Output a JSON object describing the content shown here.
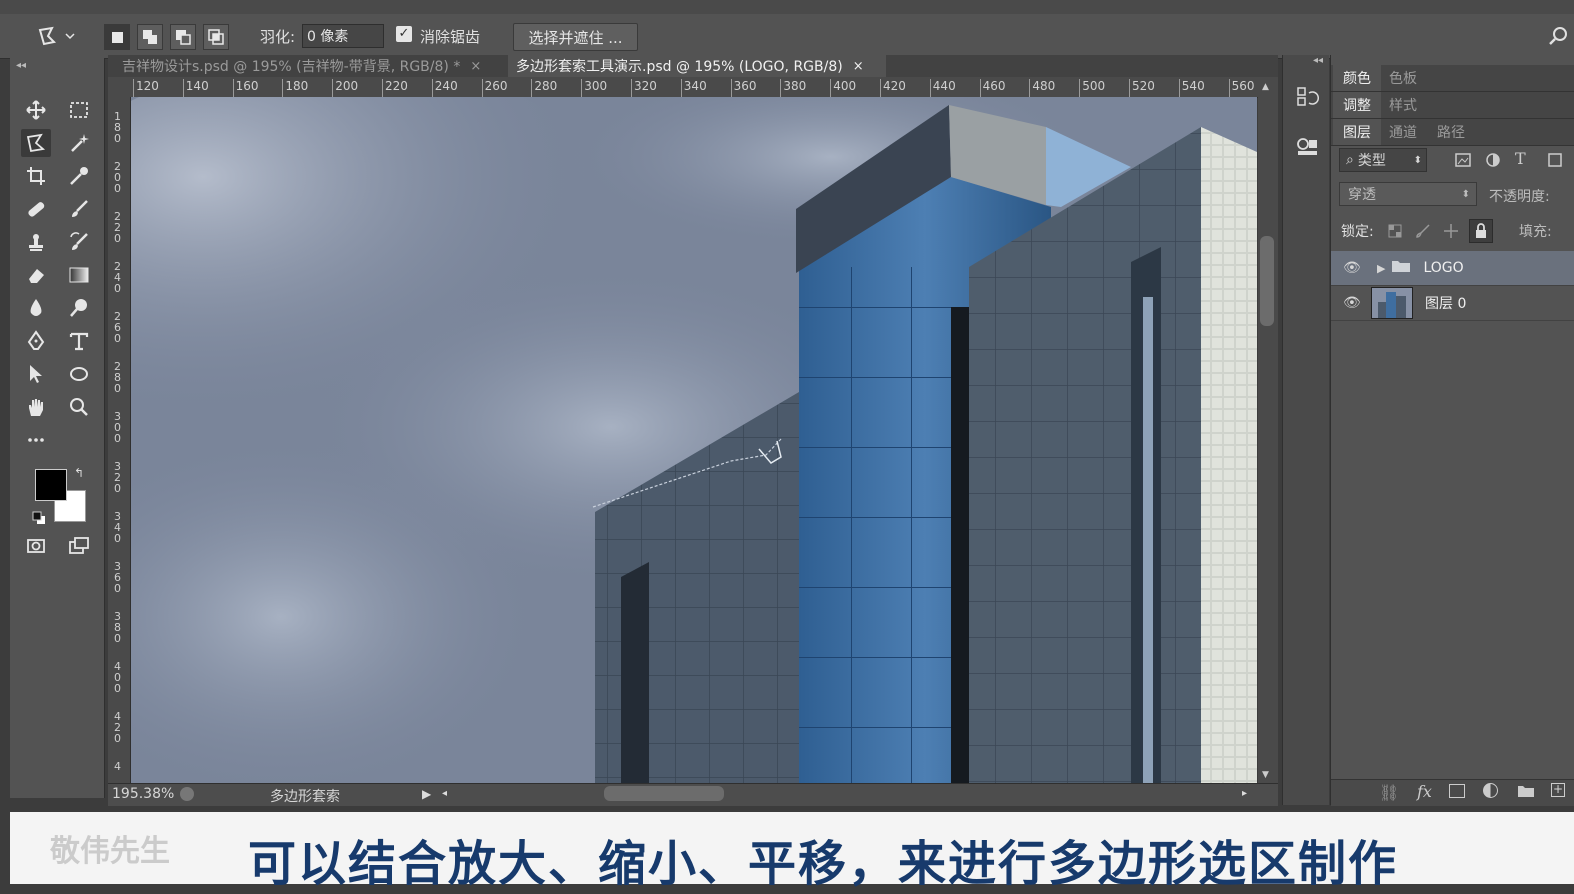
{
  "options_bar": {
    "feather_label": "羽化:",
    "feather_value": "0 像素",
    "antialias_label": "消除锯齿",
    "select_mask_label": "选择并遮住 ..."
  },
  "tabs": [
    {
      "label": "吉祥物设计s.psd @ 195% (吉祥物-带背景, RGB/8) *",
      "active": false
    },
    {
      "label": "多边形套索工具演示.psd @ 195% (LOGO, RGB/8)",
      "active": true
    }
  ],
  "tab_close": "×",
  "ruler_top_ticks": [
    "120",
    "140",
    "160",
    "180",
    "200",
    "220",
    "240",
    "260",
    "280",
    "300",
    "320",
    "340",
    "360",
    "380",
    "400",
    "420",
    "440",
    "460",
    "480",
    "500",
    "520",
    "540",
    "560"
  ],
  "ruler_left_ticks": [
    "1\n8\n0",
    "2\n0\n0",
    "2\n2\n0",
    "2\n4\n0",
    "2\n6\n0",
    "2\n8\n0",
    "3\n0\n0",
    "3\n2\n0",
    "3\n4\n0",
    "3\n6\n0",
    "3\n8\n0",
    "4\n0\n0",
    "4\n2\n0",
    "4"
  ],
  "status": {
    "zoom": "195.38%",
    "tool_name": "多边形套索"
  },
  "right_panel": {
    "tabs_row1": [
      "颜色",
      "色板"
    ],
    "tabs_row2": [
      "调整",
      "样式"
    ],
    "tabs_row3": [
      "图层",
      "通道",
      "路径"
    ],
    "filter_kind": "类型",
    "blend_mode": "穿透",
    "opacity_label": "不透明度:",
    "lock_label": "锁定:",
    "fill_label": "填充:",
    "layers": [
      {
        "name": "LOGO",
        "type": "group",
        "selected": true
      },
      {
        "name": "图层 0",
        "type": "image",
        "selected": false
      }
    ]
  },
  "caption": {
    "text": "可以结合放大、缩小、平移，来进行多边形选区制作",
    "watermark": "敬伟先生"
  },
  "colors": {
    "sky": "#76829a",
    "glass": "#3f6ea0",
    "caption_text": "#173a6c"
  }
}
